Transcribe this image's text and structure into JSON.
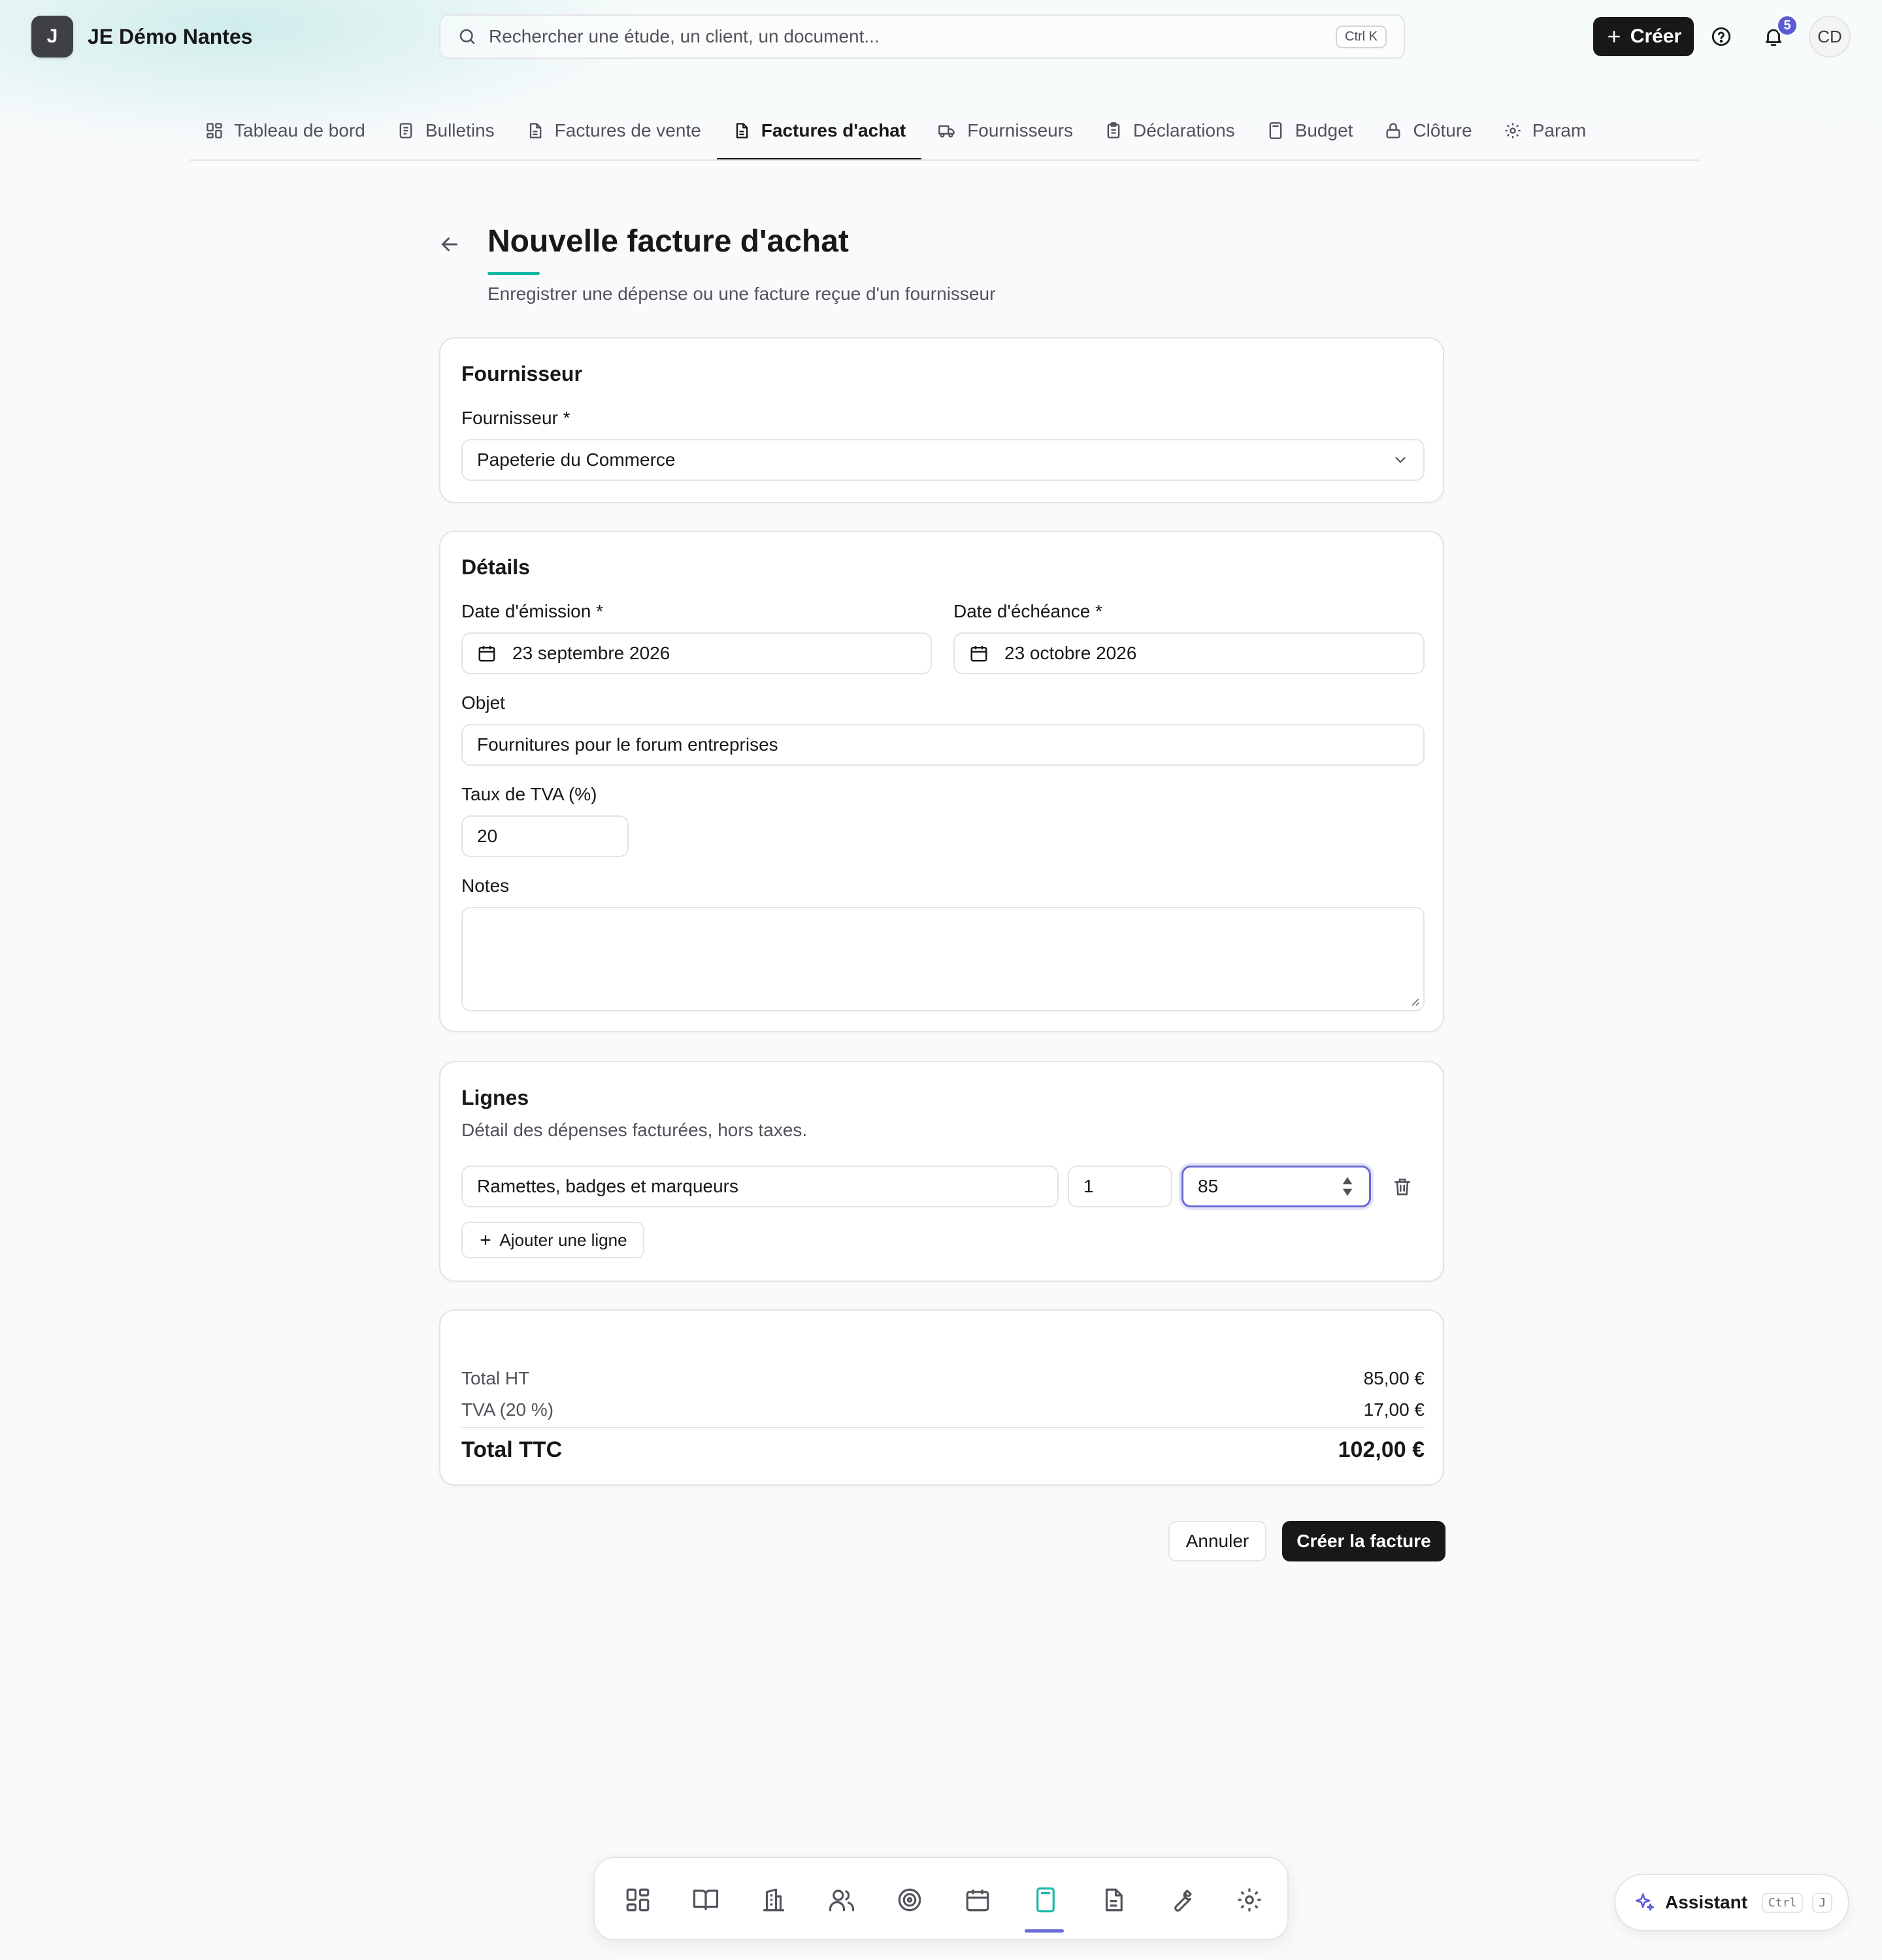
{
  "app": {
    "logo_letter": "J",
    "name": "JE Démo Nantes"
  },
  "search": {
    "placeholder": "Rechercher une étude, un client, un document...",
    "shortcut": "Ctrl K"
  },
  "header": {
    "create_label": "Créer",
    "notifications_count": "5",
    "avatar_initials": "CD"
  },
  "tabs": [
    {
      "label": "Tableau de bord",
      "icon": "dashboard-icon",
      "active": false
    },
    {
      "label": "Bulletins",
      "icon": "document-icon",
      "active": false
    },
    {
      "label": "Factures de vente",
      "icon": "document-icon",
      "active": false
    },
    {
      "label": "Factures d'achat",
      "icon": "document-icon",
      "active": true
    },
    {
      "label": "Fournisseurs",
      "icon": "truck-icon",
      "active": false
    },
    {
      "label": "Déclarations",
      "icon": "clipboard-icon",
      "active": false
    },
    {
      "label": "Budget",
      "icon": "calculator-icon",
      "active": false
    },
    {
      "label": "Clôture",
      "icon": "lock-icon",
      "active": false
    },
    {
      "label": "Param",
      "icon": "gear-icon",
      "active": false
    }
  ],
  "page": {
    "title": "Nouvelle facture d'achat",
    "subtitle": "Enregistrer une dépense ou une facture reçue d'un fournisseur"
  },
  "supplier_card": {
    "title": "Fournisseur",
    "field_label": "Fournisseur *",
    "selected_value": "Papeterie du Commerce"
  },
  "details_card": {
    "title": "Détails",
    "issue_date_label": "Date d'émission *",
    "issue_date_value": "23 septembre 2026",
    "due_date_label": "Date d'échéance *",
    "due_date_value": "23 octobre 2026",
    "subject_label": "Objet",
    "subject_value": "Fournitures pour le forum entreprises",
    "vat_label": "Taux de TVA (%)",
    "vat_value": "20",
    "notes_label": "Notes",
    "notes_value": ""
  },
  "lines_card": {
    "title": "Lignes",
    "subtitle": "Détail des dépenses facturées, hors taxes.",
    "lines": [
      {
        "description": "Ramettes, badges et marqueurs",
        "quantity": "1",
        "unit_price": "85"
      }
    ],
    "add_line_label": "Ajouter une ligne"
  },
  "totals": {
    "ht_label": "Total HT",
    "ht_value": "85,00 €",
    "vat_label": "TVA (20 %)",
    "vat_value": "17,00 €",
    "ttc_label": "Total TTC",
    "ttc_value": "102,00 €"
  },
  "actions": {
    "cancel_label": "Annuler",
    "submit_label": "Créer la facture"
  },
  "dock": {
    "items": [
      "dashboard-icon",
      "book-icon",
      "building-icon",
      "users-icon",
      "target-icon",
      "calendar-icon",
      "calculator-icon",
      "document-icon",
      "wrench-icon",
      "gear-icon"
    ],
    "active_item": "calculator-icon"
  },
  "assistant": {
    "label": "Assistant",
    "shortcut_1": "Ctrl",
    "shortcut_2": "J"
  },
  "colors": {
    "accent": "#6b6bd6",
    "title_underline": "#14b8a6",
    "primary_button": "#18181b"
  }
}
